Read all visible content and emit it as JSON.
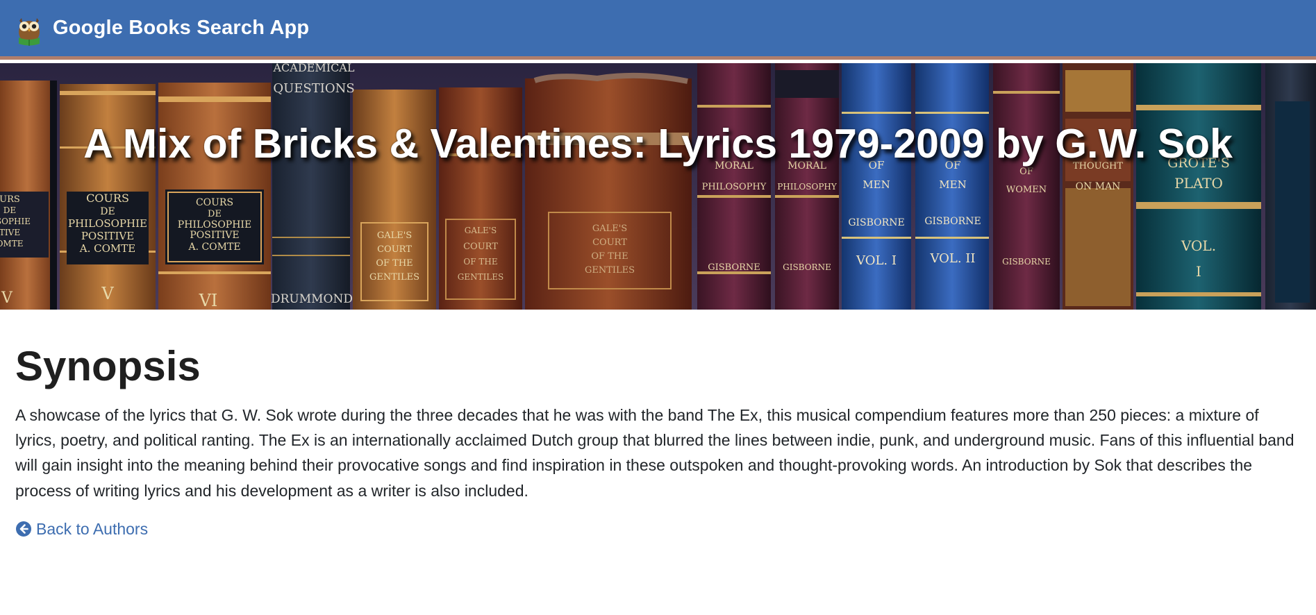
{
  "navbar": {
    "brand": "Google Books Search App",
    "logo_icon": "owl-reading-icon"
  },
  "hero": {
    "title": "A Mix of Bricks & Valentines: Lyrics 1979-2009 by G.W. Sok",
    "background": "bookshelf-of-antique-books",
    "spine_labels": {
      "academical": [
        "ACADEMICAL",
        "QUESTIONS"
      ],
      "drummond": "DRUMMOND",
      "comte_1": [
        "COURS",
        "DE",
        "PHILOSOPHIE",
        "POSITIVE",
        "A. COMTE"
      ],
      "comte_2": [
        "COURS",
        "DE",
        "PHILOSOPHIE",
        "POSITIVE",
        "A. COMTE"
      ],
      "comte_vol_v": "V",
      "comte_vol_vi": "VI",
      "gale_1": [
        "GALE'S",
        "COURT",
        "OF  THE",
        "GENTILES"
      ],
      "gale_2": [
        "GALE'S",
        "COURT",
        "OF THE",
        "GENTILES"
      ],
      "gale_3": [
        "GALE'S",
        "COURT",
        "OF THE",
        "GENTILES"
      ],
      "moral_1": [
        "MORAL",
        "PHILOSOPHY"
      ],
      "moral_2": [
        "MORAL",
        "PHILOSOPHY"
      ],
      "gisborne_1": "GISBORNE",
      "gisborne_2": "GISBORNE",
      "duties_1": [
        "OF",
        "MEN",
        "GISBORNE",
        "VOL. I"
      ],
      "duties_2": [
        "OF",
        "MEN",
        "GISBORNE",
        "VOL. II"
      ],
      "women": [
        "OF",
        "WOMEN",
        "GISBORNE"
      ],
      "thought": [
        "THOUGHT",
        "ON MAN"
      ],
      "plato": [
        "GROTE'S",
        "PLATO",
        "VOL.",
        "I"
      ],
      "left_edge": [
        "URS",
        "DE",
        "OSOPHIE",
        "TIVE",
        "OMTE",
        "V"
      ]
    }
  },
  "main": {
    "heading": "Synopsis",
    "synopsis": "A showcase of the lyrics that G. W. Sok wrote during the three decades that he was with the band The Ex, this musical compendium features more than 250 pieces: a mixture of lyrics, poetry, and political ranting. The Ex is an internationally acclaimed Dutch group that blurred the lines between indie, punk, and underground music. Fans of this influential band will gain insight into the meaning behind their provocative songs and find inspiration in these outspoken and thought-provoking words. An introduction by Sok that describes the process of writing lyrics and his development as a writer is also included.",
    "back_link": {
      "label": "Back to Authors",
      "icon": "arrow-circle-left-icon"
    }
  },
  "colors": {
    "navbar": "#3d6db0",
    "navbar_border": "#b07e6c",
    "link": "#3d6db0",
    "text": "#212529"
  }
}
